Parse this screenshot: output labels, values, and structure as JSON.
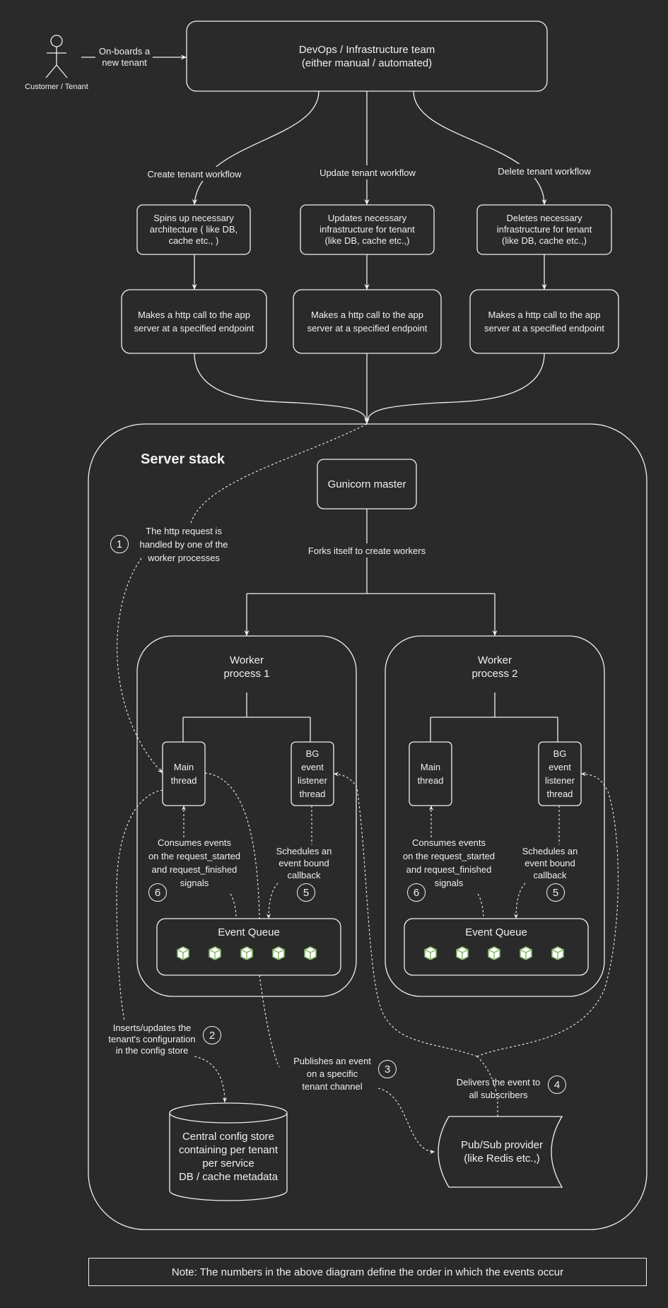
{
  "colors": {
    "background": "#2a2a2a",
    "stroke": "#f0f0f0",
    "cube_fill": "#ffffff",
    "cube_stroke": "#82b366"
  },
  "actor": {
    "label": "Customer / Tenant"
  },
  "onboard_edge": {
    "label": "On-boards a\nnew tenant"
  },
  "devops": {
    "label": "DevOps / Infrastructure team\n(either manual / automated)"
  },
  "workflows": [
    {
      "edge_label": "Create tenant workflow",
      "infra_label": "Spins up necessary\narchitecture ( like DB,\ncache etc., )",
      "http_label": "Makes a http call to the app\nserver at a specified endpoint"
    },
    {
      "edge_label": "Update tenant workflow",
      "infra_label": "Updates necessary\ninfrastructure for tenant\n(like DB, cache etc.,)",
      "http_label": "Makes a http call to the app\nserver at a specified endpoint"
    },
    {
      "edge_label": "Delete tenant workflow",
      "infra_label": "Deletes necessary\ninfrastructure for tenant\n(like DB, cache etc.,)",
      "http_label": "Makes a http call to the app\nserver at a specified endpoint"
    }
  ],
  "server_stack": {
    "title": "Server stack",
    "gunicorn": "Gunicorn master",
    "fork_label": "Forks itself to create workers",
    "step1": {
      "number": "1",
      "label": "The http request is\nhandled by one of the\nworker processes"
    },
    "workers": [
      {
        "title": "Worker\nprocess 1",
        "main_thread": "Main\nthread",
        "bg_thread": "BG\nevent\nlistener\nthread",
        "consumes": "Consumes events\non the request_started\nand request_finished\nsignals",
        "consumes_step": "6",
        "schedules": "Schedules an\nevent bound\ncallback",
        "schedules_step": "5",
        "queue_label": "Event Queue",
        "queue_items": 5
      },
      {
        "title": "Worker\nprocess 2",
        "main_thread": "Main\nthread",
        "bg_thread": "BG\nevent\nlistener\nthread",
        "consumes": "Consumes events\non the request_started\nand request_finished\nsignals",
        "consumes_step": "6",
        "schedules": "Schedules an\nevent bound\ncallback",
        "schedules_step": "5",
        "queue_label": "Event Queue",
        "queue_items": 5
      }
    ],
    "step2": {
      "number": "2",
      "label": "Inserts/updates the\ntenant's configuration\nin the config store"
    },
    "step3": {
      "number": "3",
      "label": "Publishes an event\non a specific\ntenant channel"
    },
    "step4": {
      "number": "4",
      "label": "Delivers the event to\nall subscribers"
    },
    "config_store": "Central config store\ncontaining per tenant\nper service\nDB / cache metadata",
    "pubsub": "Pub/Sub provider\n(like Redis etc.,)"
  },
  "note": "Note: The numbers in the above diagram define the order in which the events occur"
}
